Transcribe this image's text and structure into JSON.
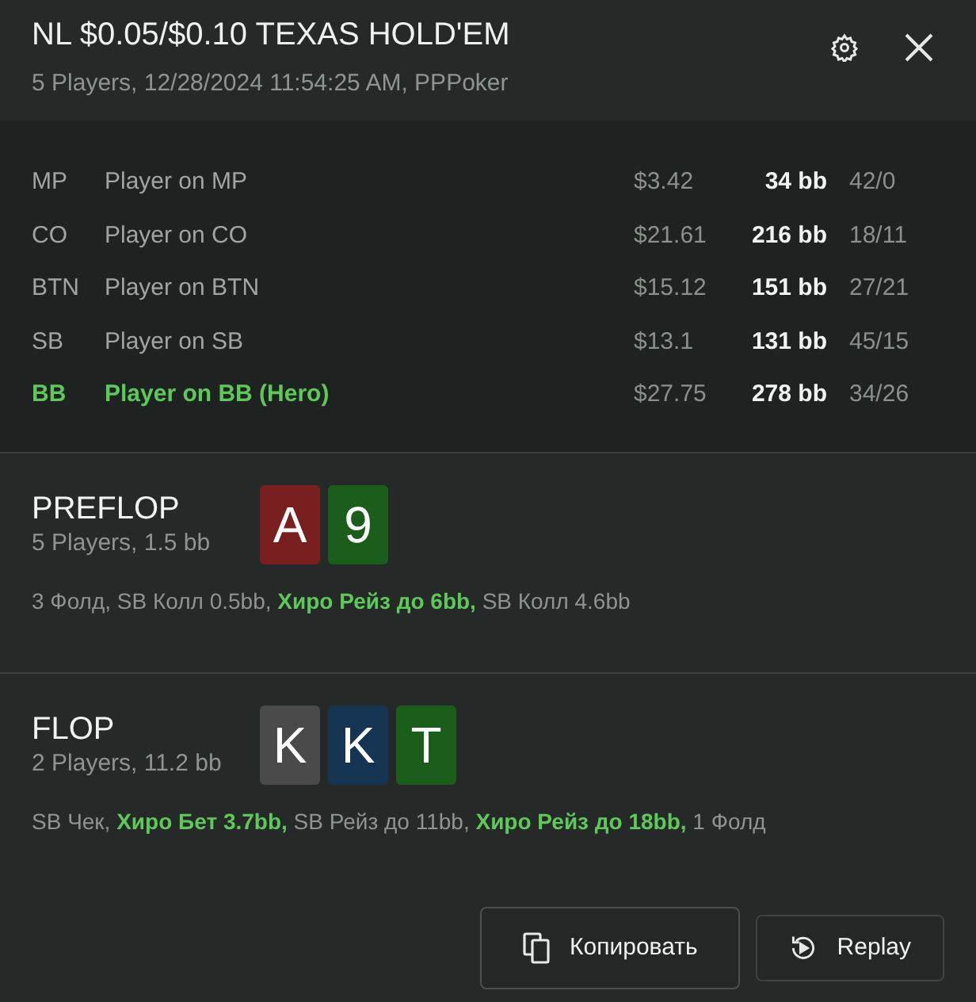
{
  "header": {
    "title": "NL $0.05/$0.10 TEXAS HOLD'EM",
    "subtitle": "5 Players, 12/28/2024 11:54:25 AM, PPPoker"
  },
  "players": [
    {
      "position": "MP",
      "name": "Player on MP",
      "money": "$3.42",
      "stack": "34 bb",
      "stats": "42/0",
      "hero": false
    },
    {
      "position": "CO",
      "name": "Player on CO",
      "money": "$21.61",
      "stack": "216 bb",
      "stats": "18/11",
      "hero": false
    },
    {
      "position": "BTN",
      "name": "Player on BTN",
      "money": "$15.12",
      "stack": "151 bb",
      "stats": "27/21",
      "hero": false
    },
    {
      "position": "SB",
      "name": "Player on SB",
      "money": "$13.1",
      "stack": "131 bb",
      "stats": "45/15",
      "hero": false
    },
    {
      "position": "BB",
      "name": "Player on BB (Hero)",
      "money": "$27.75",
      "stack": "278 bb",
      "stats": "34/26",
      "hero": true
    }
  ],
  "streets": [
    {
      "name": "PREFLOP",
      "info": "5 Players, 1.5 bb",
      "cards": [
        {
          "rank": "A",
          "color": "#7a1f1f"
        },
        {
          "rank": "9",
          "color": "#1b5e1b"
        }
      ],
      "actions": "3 Фолд, SB Колл 0.5bb, **Хиро Рейз до 6bb,** SB Колл 4.6bb"
    },
    {
      "name": "FLOP",
      "info": "2 Players, 11.2 bb",
      "cards": [
        {
          "rank": "K",
          "color": "#4a4a4a"
        },
        {
          "rank": "K",
          "color": "#163552"
        },
        {
          "rank": "T",
          "color": "#1b5e1b"
        }
      ],
      "actions": "SB Чек, **Хиро Бет 3.7bb,** SB Рейз до 11bb, **Хиро Рейз до 18bb,** 1 Фолд"
    }
  ],
  "buttons": [
    {
      "label": "Копировать",
      "kind": "copy",
      "focused": true
    },
    {
      "label": "Replay",
      "kind": "replay",
      "focused": false
    }
  ]
}
